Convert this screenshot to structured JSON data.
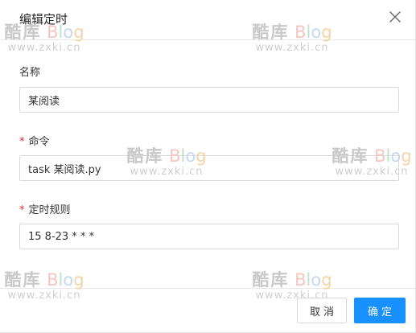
{
  "dialog": {
    "title": "编辑定时",
    "close_icon": "close-icon"
  },
  "fields": {
    "name": {
      "label": "名称",
      "value": "某阅读"
    },
    "command": {
      "label": "命令",
      "required_mark": "*",
      "value": "task 某阅读.py"
    },
    "schedule": {
      "label": "定时规则",
      "required_mark": "*",
      "value": "15 8-23 * * *"
    }
  },
  "footer": {
    "cancel_label": "取消",
    "ok_label": "确定"
  },
  "watermark": {
    "cn": "酷库",
    "b1": "B",
    "b2": "l",
    "b3": "o",
    "b4": "g",
    "url": "www.zxki.cn"
  },
  "colors": {
    "primary": "#1890ff",
    "required": "#f5222d",
    "border": "#d9d9d9"
  }
}
